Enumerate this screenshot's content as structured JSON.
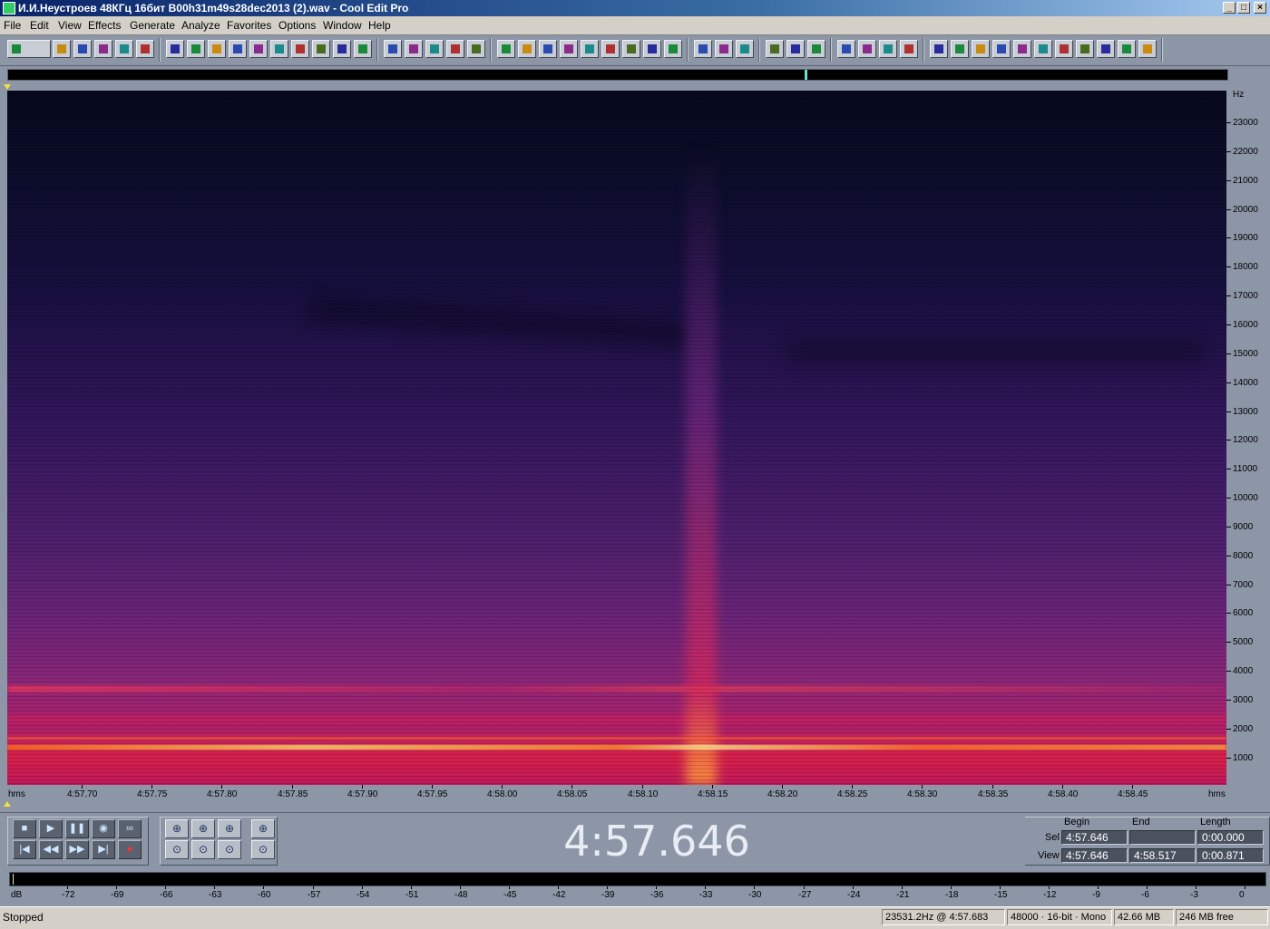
{
  "window": {
    "title": "И.И.Неустроев 48КГц 16бит B00h31m49s28dec2013 (2).wav - Cool Edit Pro"
  },
  "menu": [
    "File",
    "Edit",
    "View",
    "Effects",
    "Generate",
    "Analyze",
    "Favorites",
    "Options",
    "Window",
    "Help"
  ],
  "toolbar_icons": [
    "waveform-view-icon",
    "new-file-icon",
    "open-file-icon",
    "save-icon",
    "save-as-icon",
    "close-file-icon",
    "undo-icon",
    "redo-icon",
    "repeat-icon",
    "copy-icon",
    "paste-icon",
    "cut-icon",
    "trim-icon",
    "mix-paste-icon",
    "paste-new-icon",
    "find-icon",
    "envelope-icon",
    "normalize-icon",
    "markers-icon",
    "cue-list-icon",
    "loop-icon",
    "spectral-view-icon",
    "info-icon",
    "properties-icon",
    "play-region-icon",
    "zoom-icon",
    "time-format-icon",
    "snap-icon",
    "color-icon",
    "grid-icon",
    "settings-icon",
    "script-icon",
    "help-icon",
    "frequency-analysis-icon",
    "zoom-in-icon",
    "zoom-full-icon",
    "edit-view-icon",
    "multitrack-view-icon",
    "cd-project-icon",
    "session-icon",
    "filter-icon",
    "delay-icon",
    "amplitude-icon",
    "noise-reduction-icon",
    "reverb-icon",
    "pitch-icon",
    "generate-tones-icon",
    "analysis-icon",
    "equalizer-icon",
    "stretch-icon",
    "batch-icon"
  ],
  "spectrogram": {
    "freq_unit": "Hz",
    "freq_labels": [
      "23000",
      "22000",
      "21000",
      "20000",
      "19000",
      "18000",
      "17000",
      "16000",
      "15000",
      "14000",
      "13000",
      "12000",
      "11000",
      "10000",
      "9000",
      "8000",
      "7000",
      "6000",
      "5000",
      "4000",
      "3000",
      "2000",
      "1000"
    ],
    "time_unit_left": "hms",
    "time_unit_right": "hms",
    "time_labels": [
      "4:57.70",
      "4:57.75",
      "4:57.80",
      "4:57.85",
      "4:57.90",
      "4:57.95",
      "4:58.00",
      "4:58.05",
      "4:58.10",
      "4:58.15",
      "4:58.20",
      "4:58.25",
      "4:58.30",
      "4:58.35",
      "4:58.40",
      "4:58.45"
    ]
  },
  "transport": {
    "current_time": "4:57.646",
    "buttons_row1": [
      "stop-icon",
      "play-icon",
      "pause-icon",
      "play-to-end-icon",
      "loop-play-icon"
    ],
    "buttons_row2": [
      "go-to-start-icon",
      "rewind-icon",
      "fast-forward-icon",
      "go-to-end-icon",
      "record-icon"
    ]
  },
  "selection": {
    "headers": {
      "begin": "Begin",
      "end": "End",
      "length": "Length"
    },
    "sel_label": "Sel",
    "view_label": "View",
    "sel": {
      "begin": "4:57.646",
      "end": "",
      "length": "0:00.000"
    },
    "view": {
      "begin": "4:57.646",
      "end": "4:58.517",
      "length": "0:00.871"
    }
  },
  "meter": {
    "unit": "dB",
    "labels": [
      "-72",
      "-69",
      "-66",
      "-63",
      "-60",
      "-57",
      "-54",
      "-51",
      "-48",
      "-45",
      "-42",
      "-39",
      "-36",
      "-33",
      "-30",
      "-27",
      "-24",
      "-21",
      "-18",
      "-15",
      "-12",
      "-9",
      "-6",
      "-3",
      "0"
    ]
  },
  "status": {
    "state": "Stopped",
    "cursor": "23531.2Hz @ 4:57.683",
    "format": "48000 · 16-bit · Mono",
    "file_size": "42.66 MB",
    "free": "246 MB free"
  }
}
